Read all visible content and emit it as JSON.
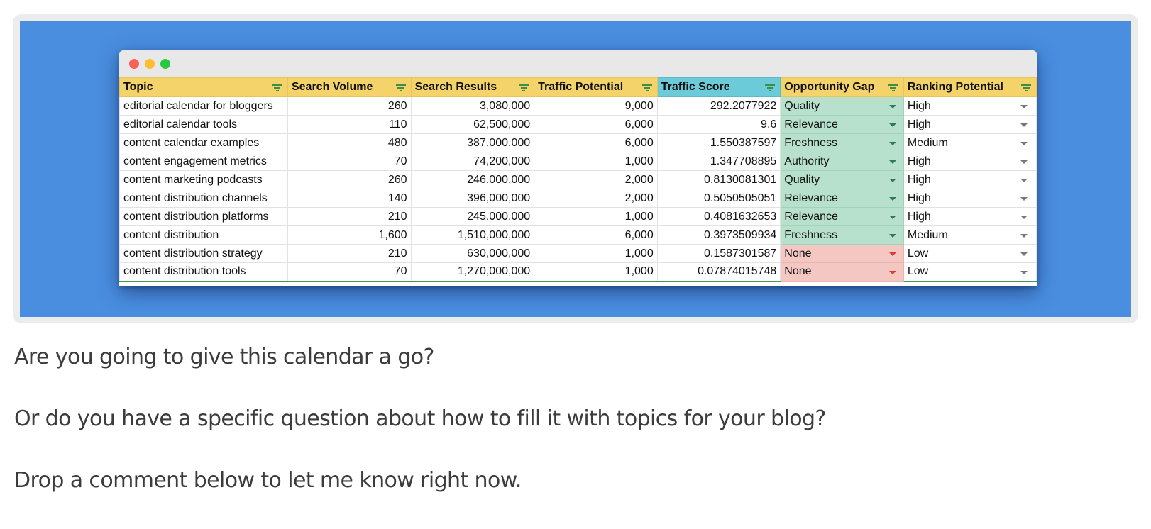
{
  "window": {
    "controls": [
      "close",
      "minimize",
      "maximize"
    ]
  },
  "sheet": {
    "columns": [
      {
        "label": "Topic",
        "highlight": false
      },
      {
        "label": "Search Volume",
        "highlight": false
      },
      {
        "label": "Search Results",
        "highlight": false
      },
      {
        "label": "Traffic Potential",
        "highlight": false
      },
      {
        "label": "Traffic Score",
        "highlight": true
      },
      {
        "label": "Opportunity Gap",
        "highlight": false
      },
      {
        "label": "Ranking Potential",
        "highlight": false
      }
    ],
    "colors": {
      "header": "#f4d36b",
      "header_highlight": "#6ccbd9",
      "gap_good": "#b7e1cd",
      "gap_bad": "#f4c7c3"
    },
    "rows": [
      {
        "topic": "editorial calendar for bloggers",
        "search_volume": "260",
        "search_results": "3,080,000",
        "traffic_potential": "9,000",
        "traffic_score": "292.2077922",
        "opportunity_gap": "Quality",
        "gap_status": "good",
        "ranking_potential": "High"
      },
      {
        "topic": "editorial calendar tools",
        "search_volume": "110",
        "search_results": "62,500,000",
        "traffic_potential": "6,000",
        "traffic_score": "9.6",
        "opportunity_gap": "Relevance",
        "gap_status": "good",
        "ranking_potential": "High"
      },
      {
        "topic": "content calendar examples",
        "search_volume": "480",
        "search_results": "387,000,000",
        "traffic_potential": "6,000",
        "traffic_score": "1.550387597",
        "opportunity_gap": "Freshness",
        "gap_status": "good",
        "ranking_potential": "Medium"
      },
      {
        "topic": "content engagement metrics",
        "search_volume": "70",
        "search_results": "74,200,000",
        "traffic_potential": "1,000",
        "traffic_score": "1.347708895",
        "opportunity_gap": "Authority",
        "gap_status": "good",
        "ranking_potential": "High"
      },
      {
        "topic": "content marketing podcasts",
        "search_volume": "260",
        "search_results": "246,000,000",
        "traffic_potential": "2,000",
        "traffic_score": "0.8130081301",
        "opportunity_gap": "Quality",
        "gap_status": "good",
        "ranking_potential": "High"
      },
      {
        "topic": "content distribution channels",
        "search_volume": "140",
        "search_results": "396,000,000",
        "traffic_potential": "2,000",
        "traffic_score": "0.5050505051",
        "opportunity_gap": "Relevance",
        "gap_status": "good",
        "ranking_potential": "High"
      },
      {
        "topic": "content distribution platforms",
        "search_volume": "210",
        "search_results": "245,000,000",
        "traffic_potential": "1,000",
        "traffic_score": "0.4081632653",
        "opportunity_gap": "Relevance",
        "gap_status": "good",
        "ranking_potential": "High"
      },
      {
        "topic": "content distribution",
        "search_volume": "1,600",
        "search_results": "1,510,000,000",
        "traffic_potential": "6,000",
        "traffic_score": "0.3973509934",
        "opportunity_gap": "Freshness",
        "gap_status": "good",
        "ranking_potential": "Medium"
      },
      {
        "topic": "content distribution strategy",
        "search_volume": "210",
        "search_results": "630,000,000",
        "traffic_potential": "1,000",
        "traffic_score": "0.1587301587",
        "opportunity_gap": "None",
        "gap_status": "bad",
        "ranking_potential": "Low"
      },
      {
        "topic": "content distribution tools",
        "search_volume": "70",
        "search_results": "1,270,000,000",
        "traffic_potential": "1,000",
        "traffic_score": "0.07874015748",
        "opportunity_gap": "None",
        "gap_status": "bad",
        "ranking_potential": "Low"
      }
    ]
  },
  "article": {
    "paragraphs": [
      "Are you going to give this calendar a go?",
      "Or do you have a specific question about how to fill it with topics for your blog?",
      "Drop a comment below to let me know right now."
    ]
  }
}
